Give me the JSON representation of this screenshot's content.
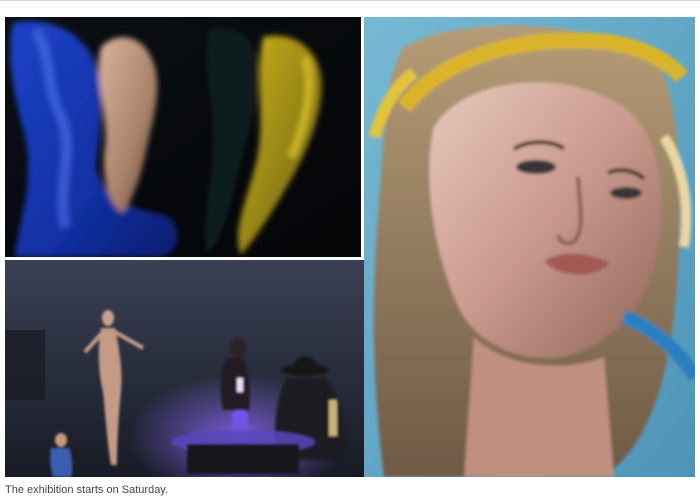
{
  "caption": "The exhibition starts on Saturday."
}
